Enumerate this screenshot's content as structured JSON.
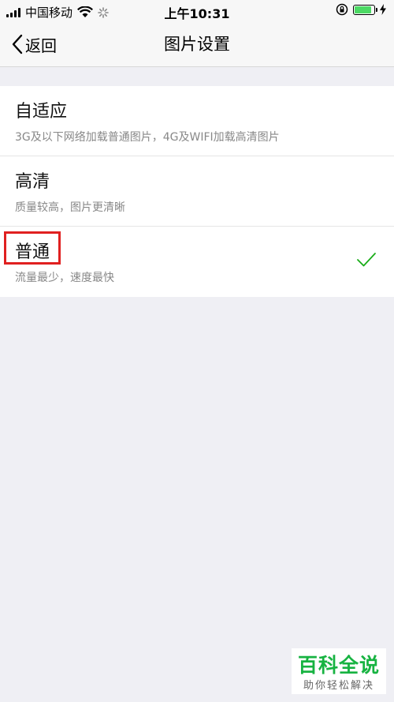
{
  "status_bar": {
    "carrier": "中国移动",
    "time": "上午10:31"
  },
  "nav": {
    "back_label": "返回",
    "title": "图片设置"
  },
  "options": [
    {
      "title": "自适应",
      "description": "3G及以下网络加载普通图片，4G及WIFI加载高清图片",
      "selected": false
    },
    {
      "title": "高清",
      "description": "质量较高，图片更清晰",
      "selected": false
    },
    {
      "title": "普通",
      "description": "流量最少，速度最快",
      "selected": true
    }
  ],
  "colors": {
    "accent_check": "#1aad19",
    "highlight_box": "#e02020",
    "battery": "#4cd964"
  },
  "watermark": {
    "logo": "百科全说",
    "tagline": "助你轻松解决"
  }
}
